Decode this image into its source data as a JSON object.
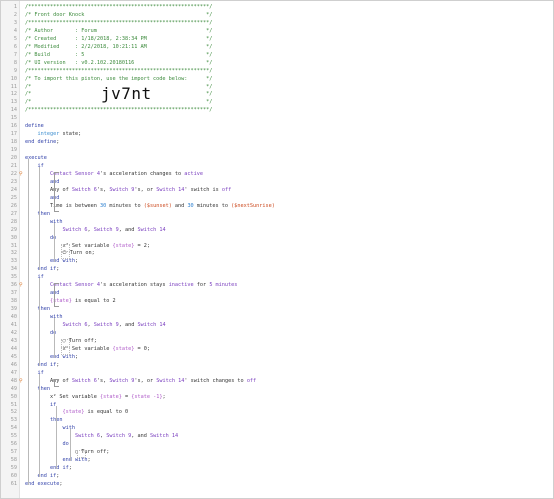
{
  "lines": [
    {
      "n": "1",
      "parts": [
        {
          "t": "/**********************************************************/",
          "c": "c"
        }
      ]
    },
    {
      "n": "2",
      "parts": [
        {
          "t": "/* Front door Knock                                       */",
          "c": "c"
        }
      ]
    },
    {
      "n": "3",
      "parts": [
        {
          "t": "/**********************************************************/",
          "c": "c"
        }
      ]
    },
    {
      "n": "4",
      "parts": [
        {
          "t": "/* Author       : Forum                                   */",
          "c": "c"
        }
      ]
    },
    {
      "n": "5",
      "parts": [
        {
          "t": "/* Created      : 1/18/2018, 2:38:34 PM                   */",
          "c": "c"
        }
      ]
    },
    {
      "n": "6",
      "parts": [
        {
          "t": "/* Modified     : 2/2/2018, 10:21:11 AM                   */",
          "c": "c"
        }
      ]
    },
    {
      "n": "7",
      "parts": [
        {
          "t": "/* Build        : 5                                       */",
          "c": "c"
        }
      ]
    },
    {
      "n": "8",
      "parts": [
        {
          "t": "/* UI version   : v0.2.102.20180116                       */",
          "c": "c"
        }
      ]
    },
    {
      "n": "9",
      "parts": [
        {
          "t": "/**********************************************************/",
          "c": "c"
        }
      ]
    },
    {
      "n": "10",
      "parts": [
        {
          "t": "/* To import this piston, use the import code below:      */",
          "c": "c"
        }
      ]
    },
    {
      "n": "11",
      "parts": [
        {
          "t": "/*                                                        */",
          "c": "c"
        }
      ]
    },
    {
      "n": "12",
      "parts": [
        {
          "t": "/*                                                        */",
          "c": "c"
        }
      ]
    },
    {
      "n": "13",
      "parts": [
        {
          "t": "/*                                                        */",
          "c": "c"
        }
      ]
    },
    {
      "n": "14",
      "parts": [
        {
          "t": "/**********************************************************/",
          "c": "c"
        }
      ]
    },
    {
      "n": "15",
      "parts": []
    },
    {
      "n": "16",
      "parts": [
        {
          "t": "define",
          "c": "kw"
        }
      ]
    },
    {
      "n": "17",
      "parts": [
        {
          "t": "    integer ",
          "c": "ty"
        },
        {
          "t": "state",
          "c": ""
        },
        {
          "t": ";",
          "c": ""
        }
      ]
    },
    {
      "n": "18",
      "parts": [
        {
          "t": "end define",
          "c": "kw"
        },
        {
          "t": ";",
          "c": ""
        }
      ]
    },
    {
      "n": "19",
      "parts": []
    },
    {
      "n": "20",
      "parts": [
        {
          "t": "execute",
          "c": "kw"
        }
      ]
    },
    {
      "n": "21",
      "parts": [
        {
          "t": "    if",
          "c": "kw"
        }
      ]
    },
    {
      "n": "22",
      "parts": [
        {
          "t": "        Contact Sensor 4",
          "c": "dev"
        },
        {
          "t": "'s acceleration changes to ",
          "c": ""
        },
        {
          "t": "active",
          "c": "dev"
        }
      ]
    },
    {
      "n": "23",
      "parts": [
        {
          "t": "        and",
          "c": "kw"
        }
      ]
    },
    {
      "n": "24",
      "parts": [
        {
          "t": "        Any of ",
          "c": ""
        },
        {
          "t": "Switch 6",
          "c": "dev"
        },
        {
          "t": "'s, ",
          "c": ""
        },
        {
          "t": "Switch 9",
          "c": "dev"
        },
        {
          "t": "'s, or ",
          "c": ""
        },
        {
          "t": "Switch 14",
          "c": "dev"
        },
        {
          "t": "' switch is ",
          "c": ""
        },
        {
          "t": "off",
          "c": "dev"
        }
      ]
    },
    {
      "n": "25",
      "parts": [
        {
          "t": "        and",
          "c": "kw"
        }
      ]
    },
    {
      "n": "26",
      "parts": [
        {
          "t": "        Time is between ",
          "c": ""
        },
        {
          "t": "30",
          "c": "num"
        },
        {
          "t": " minutes to ",
          "c": ""
        },
        {
          "t": "($sunset)",
          "c": "str"
        },
        {
          "t": " and ",
          "c": ""
        },
        {
          "t": "30",
          "c": "num"
        },
        {
          "t": " minutes to ",
          "c": ""
        },
        {
          "t": "($nextSunrise)",
          "c": "str"
        }
      ]
    },
    {
      "n": "27",
      "parts": [
        {
          "t": "    then",
          "c": "kw"
        }
      ]
    },
    {
      "n": "28",
      "parts": [
        {
          "t": "        with",
          "c": "kw"
        }
      ]
    },
    {
      "n": "29",
      "parts": [
        {
          "t": "            Switch 6",
          "c": "dev"
        },
        {
          "t": ", ",
          "c": ""
        },
        {
          "t": "Switch 9",
          "c": "dev"
        },
        {
          "t": ", and ",
          "c": ""
        },
        {
          "t": "Switch 14",
          "c": "dev"
        }
      ]
    },
    {
      "n": "30",
      "parts": [
        {
          "t": "        do",
          "c": "kw"
        }
      ]
    },
    {
      "n": "31",
      "parts": [
        {
          "t": "            x² Set variable ",
          "c": ""
        },
        {
          "t": "{state}",
          "c": "var"
        },
        {
          "t": " = 2;",
          "c": ""
        }
      ]
    },
    {
      "n": "32",
      "parts": [
        {
          "t": "            ⏻ Turn on;",
          "c": ""
        }
      ]
    },
    {
      "n": "33",
      "parts": [
        {
          "t": "        end with",
          "c": "kw"
        },
        {
          "t": ";",
          "c": ""
        }
      ]
    },
    {
      "n": "34",
      "parts": [
        {
          "t": "    end if",
          "c": "kw"
        },
        {
          "t": ";",
          "c": ""
        }
      ]
    },
    {
      "n": "35",
      "parts": [
        {
          "t": "    if",
          "c": "kw"
        }
      ]
    },
    {
      "n": "36",
      "parts": [
        {
          "t": "        Contact Sensor 4",
          "c": "dev"
        },
        {
          "t": "'s acceleration stays ",
          "c": ""
        },
        {
          "t": "inactive",
          "c": "dev"
        },
        {
          "t": " for ",
          "c": ""
        },
        {
          "t": "5 minutes",
          "c": "dev"
        }
      ]
    },
    {
      "n": "37",
      "parts": [
        {
          "t": "        and",
          "c": "kw"
        }
      ]
    },
    {
      "n": "38",
      "parts": [
        {
          "t": "        ",
          "c": ""
        },
        {
          "t": "{state}",
          "c": "var"
        },
        {
          "t": " is equal to 2",
          "c": ""
        }
      ]
    },
    {
      "n": "39",
      "parts": [
        {
          "t": "    then",
          "c": "kw"
        }
      ]
    },
    {
      "n": "40",
      "parts": [
        {
          "t": "        with",
          "c": "kw"
        }
      ]
    },
    {
      "n": "41",
      "parts": [
        {
          "t": "            Switch 6",
          "c": "dev"
        },
        {
          "t": ", ",
          "c": ""
        },
        {
          "t": "Switch 9",
          "c": "dev"
        },
        {
          "t": ", and ",
          "c": ""
        },
        {
          "t": "Switch 14",
          "c": "dev"
        }
      ]
    },
    {
      "n": "42",
      "parts": [
        {
          "t": "        do",
          "c": "kw"
        }
      ]
    },
    {
      "n": "43",
      "parts": [
        {
          "t": "            ○ Turn off;",
          "c": ""
        }
      ]
    },
    {
      "n": "44",
      "parts": [
        {
          "t": "            x² Set variable ",
          "c": ""
        },
        {
          "t": "{state}",
          "c": "var"
        },
        {
          "t": " = 0;",
          "c": ""
        }
      ]
    },
    {
      "n": "45",
      "parts": [
        {
          "t": "        end with",
          "c": "kw"
        },
        {
          "t": ";",
          "c": ""
        }
      ]
    },
    {
      "n": "46",
      "parts": [
        {
          "t": "    end if",
          "c": "kw"
        },
        {
          "t": ";",
          "c": ""
        }
      ]
    },
    {
      "n": "47",
      "parts": [
        {
          "t": "    if",
          "c": "kw"
        }
      ]
    },
    {
      "n": "48",
      "parts": [
        {
          "t": "        Any of ",
          "c": ""
        },
        {
          "t": "Switch 6",
          "c": "dev"
        },
        {
          "t": "'s, ",
          "c": ""
        },
        {
          "t": "Switch 9",
          "c": "dev"
        },
        {
          "t": "'s, or ",
          "c": ""
        },
        {
          "t": "Switch 14",
          "c": "dev"
        },
        {
          "t": "' switch changes to ",
          "c": ""
        },
        {
          "t": "off",
          "c": "dev"
        }
      ]
    },
    {
      "n": "49",
      "parts": [
        {
          "t": "    then",
          "c": "kw"
        }
      ]
    },
    {
      "n": "50",
      "parts": [
        {
          "t": "        x² Set variable ",
          "c": ""
        },
        {
          "t": "{state}",
          "c": "var"
        },
        {
          "t": " = ",
          "c": ""
        },
        {
          "t": "{state -1}",
          "c": "var"
        },
        {
          "t": ";",
          "c": ""
        }
      ]
    },
    {
      "n": "51",
      "parts": [
        {
          "t": "        if",
          "c": "kw"
        }
      ]
    },
    {
      "n": "52",
      "parts": [
        {
          "t": "            ",
          "c": ""
        },
        {
          "t": "{state}",
          "c": "var"
        },
        {
          "t": " is equal to 0",
          "c": ""
        }
      ]
    },
    {
      "n": "53",
      "parts": [
        {
          "t": "        then",
          "c": "kw"
        }
      ]
    },
    {
      "n": "54",
      "parts": [
        {
          "t": "            with",
          "c": "kw"
        }
      ]
    },
    {
      "n": "55",
      "parts": [
        {
          "t": "                Switch 6",
          "c": "dev"
        },
        {
          "t": ", ",
          "c": ""
        },
        {
          "t": "Switch 9",
          "c": "dev"
        },
        {
          "t": ", and ",
          "c": ""
        },
        {
          "t": "Switch 14",
          "c": "dev"
        }
      ]
    },
    {
      "n": "56",
      "parts": [
        {
          "t": "            do",
          "c": "kw"
        }
      ]
    },
    {
      "n": "57",
      "parts": [
        {
          "t": "                ○ Turn off;",
          "c": ""
        }
      ]
    },
    {
      "n": "58",
      "parts": [
        {
          "t": "            end with",
          "c": "kw"
        },
        {
          "t": ";",
          "c": ""
        }
      ]
    },
    {
      "n": "59",
      "parts": [
        {
          "t": "        end if",
          "c": "kw"
        },
        {
          "t": ";",
          "c": ""
        }
      ]
    },
    {
      "n": "60",
      "parts": [
        {
          "t": "    end if",
          "c": "kw"
        },
        {
          "t": ";",
          "c": ""
        }
      ]
    },
    {
      "n": "61",
      "parts": [
        {
          "t": "end execute",
          "c": "kw"
        },
        {
          "t": ";",
          "c": ""
        }
      ]
    }
  ],
  "import_code": "jv7nt",
  "markers": [
    "22",
    "36",
    "48"
  ],
  "marker_glyph": "⚲",
  "colors": {
    "comment": "#3b8a3b",
    "keyword": "#2f3fa8",
    "device": "#7a3fbf",
    "variable": "#b05cc9",
    "string": "#cc4a1f",
    "number": "#2a7fd0"
  }
}
